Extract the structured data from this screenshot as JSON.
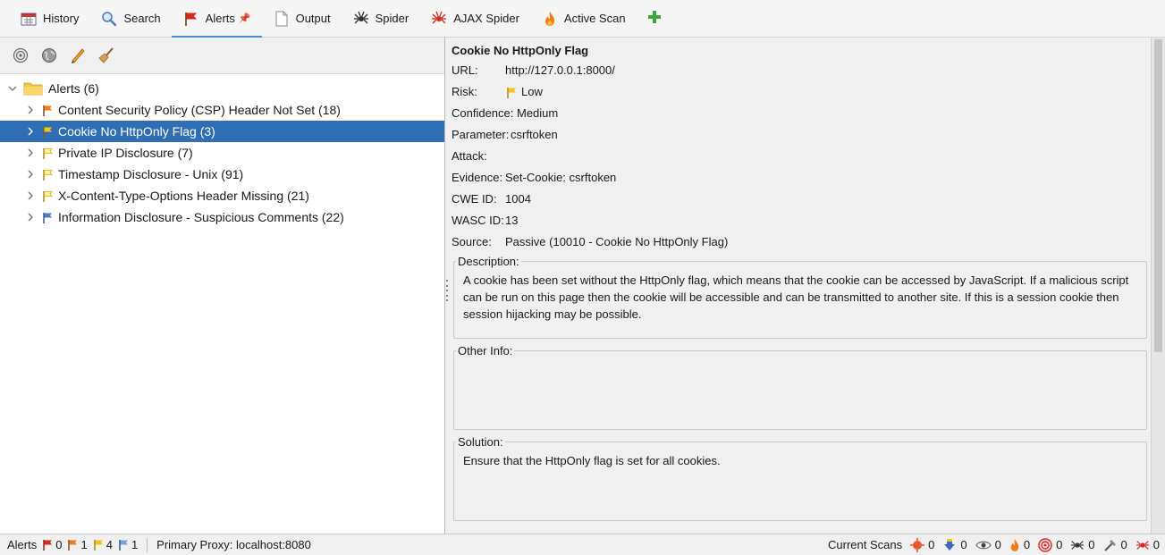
{
  "tabs": [
    {
      "label": "History",
      "icon": "calendar-icon"
    },
    {
      "label": "Search",
      "icon": "magnifier-icon"
    },
    {
      "label": "Alerts",
      "icon": "flag-icon",
      "active": true
    },
    {
      "label": "Output",
      "icon": "document-icon"
    },
    {
      "label": "Spider",
      "icon": "spider-icon"
    },
    {
      "label": "AJAX Spider",
      "icon": "ajax-spider-icon"
    },
    {
      "label": "Active Scan",
      "icon": "flame-icon"
    }
  ],
  "tab_pin": "📌",
  "alerts_tree": {
    "root_label": "Alerts (6)",
    "items": [
      {
        "label": "Content Security Policy (CSP) Header Not Set (18)",
        "risk": "medium"
      },
      {
        "label": "Cookie No HttpOnly Flag (3)",
        "risk": "low",
        "selected": true
      },
      {
        "label": "Private IP Disclosure (7)",
        "risk": "low"
      },
      {
        "label": "Timestamp Disclosure - Unix (91)",
        "risk": "low"
      },
      {
        "label": "X-Content-Type-Options Header Missing (21)",
        "risk": "low"
      },
      {
        "label": "Information Disclosure - Suspicious Comments (22)",
        "risk": "informational"
      }
    ]
  },
  "detail": {
    "title": "Cookie No HttpOnly Flag",
    "url_label": "URL:",
    "url": "http://127.0.0.1:8000/",
    "risk_label": "Risk:",
    "risk": "Low",
    "confidence": "Confidence: Medium",
    "parameter_label": "Parameter:",
    "parameter": "csrftoken",
    "attack_label": "Attack:",
    "evidence_label": "Evidence:",
    "evidence": "Set-Cookie: csrftoken",
    "cwe_label": "CWE ID:",
    "cwe": "1004",
    "wasc_label": "WASC ID:",
    "wasc": "13",
    "source_label": "Source:",
    "source": "Passive (10010 - Cookie No HttpOnly Flag)",
    "description_label": "Description:",
    "description": "A cookie has been set without the HttpOnly flag, which means that the cookie can be accessed by JavaScript. If a malicious script can be run on this page then the cookie will be accessible and can be transmitted to another site. If this is a session cookie then session hijacking may be possible.",
    "other_info_label": "Other Info:",
    "other_info": "",
    "solution_label": "Solution:",
    "solution": "Ensure that the HttpOnly flag is set for all cookies."
  },
  "status": {
    "alerts_label": "Alerts",
    "high": "0",
    "medium": "1",
    "low": "4",
    "info": "1",
    "proxy": "Primary Proxy: localhost:8080",
    "current_scans_label": "Current Scans",
    "scans": [
      "0",
      "0",
      "0",
      "0",
      "0",
      "0",
      "0",
      "0"
    ]
  },
  "colors": {
    "high": "#d42a1e",
    "medium": "#f07b1a",
    "low": "#f0c419",
    "informational": "#4a7cc9",
    "selection": "#2f6db5",
    "tab_underline": "#4a8fd4"
  }
}
